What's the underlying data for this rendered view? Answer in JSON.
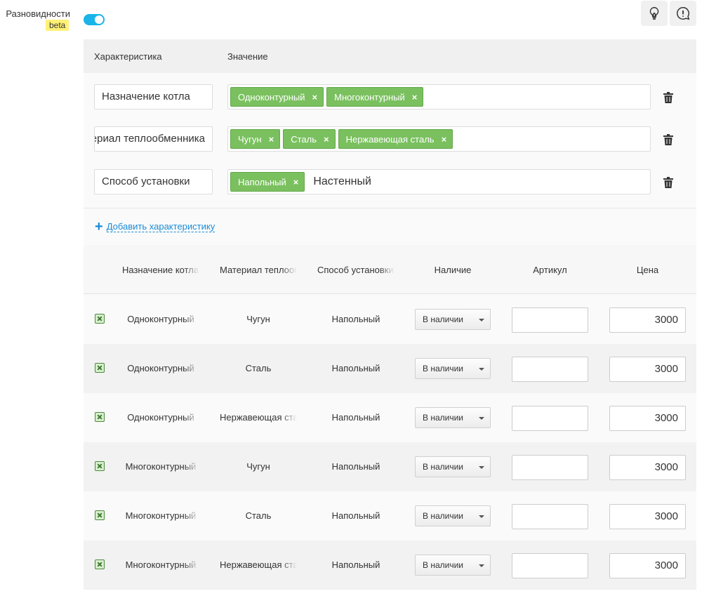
{
  "variants_toggle": {
    "label": "Разновидности",
    "badge": "beta",
    "enabled": true
  },
  "toolbar": {
    "hint_icon": "lightbulb-icon",
    "feedback_icon": "exclamation-bubble-icon"
  },
  "characteristics": {
    "header": {
      "name": "Характеристика",
      "value": "Значение"
    },
    "rows": [
      {
        "name": "Назначение котла",
        "tags": [
          "Одноконтурный",
          "Многоконтурный"
        ],
        "typed": ""
      },
      {
        "name": "Материал теплообменника",
        "tags": [
          "Чугун",
          "Сталь",
          "Нержавеющая сталь"
        ],
        "typed": ""
      },
      {
        "name": "Способ установки",
        "tags": [
          "Напольный"
        ],
        "typed": "Настенный"
      }
    ],
    "add_label": "Добавить характеристику"
  },
  "variants": {
    "headers": [
      "Назначение котла",
      "Материал теплообменника",
      "Способ установки",
      "Наличие",
      "Артикул",
      "Цена"
    ],
    "rows": [
      {
        "purpose": "Одноконтурный",
        "material": "Чугун",
        "install": "Напольный",
        "availability": "В наличии",
        "sku": "",
        "price": "3000"
      },
      {
        "purpose": "Одноконтурный",
        "material": "Сталь",
        "install": "Напольный",
        "availability": "В наличии",
        "sku": "",
        "price": "3000"
      },
      {
        "purpose": "Одноконтурный",
        "material": "Нержавеющая сталь",
        "install": "Напольный",
        "availability": "В наличии",
        "sku": "",
        "price": "3000"
      },
      {
        "purpose": "Многоконтурный",
        "material": "Чугун",
        "install": "Напольный",
        "availability": "В наличии",
        "sku": "",
        "price": "3000"
      },
      {
        "purpose": "Многоконтурный",
        "material": "Сталь",
        "install": "Напольный",
        "availability": "В наличии",
        "sku": "",
        "price": "3000"
      },
      {
        "purpose": "Многоконтурный",
        "material": "Нержавеющая сталь",
        "install": "Напольный",
        "availability": "В наличии",
        "sku": "",
        "price": "3000"
      }
    ]
  },
  "colors": {
    "accent": "#1ab4e8",
    "tag_green": "#7ac05f",
    "link": "#1a8cd8",
    "badge": "#fff176"
  }
}
